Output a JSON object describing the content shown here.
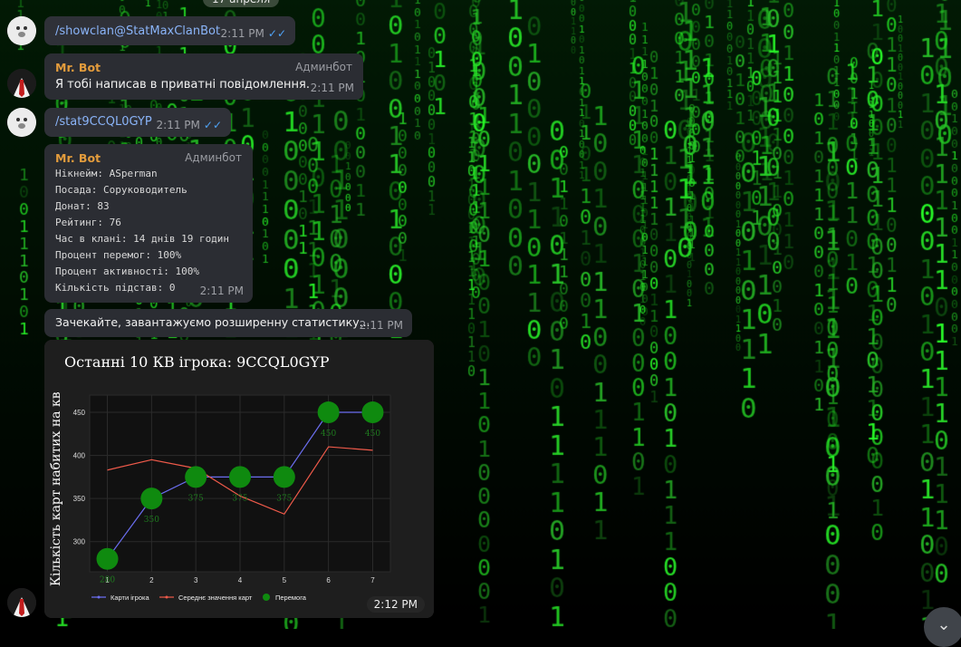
{
  "date_pill": "17 апреля",
  "messages": [
    {
      "type": "out",
      "text": "/showclan@StatMaxClanBot",
      "time": "2:11 PM"
    },
    {
      "type": "in",
      "sender": "Mr. Bot",
      "role": "Админбот",
      "text": "Я тобі написав в приватні повідомлення.",
      "time": "2:11 PM"
    },
    {
      "type": "out",
      "text": "/stat9CCQL0GYP",
      "time": "2:11 PM"
    },
    {
      "type": "in",
      "sender": "Mr. Bot",
      "role": "Админбот",
      "lines": [
        "Нікнейм: ASperman",
        "Посада: Соруководитель",
        "Донат: 83",
        "Рейтинг: 76",
        "Час в клані: 14 днів 19 годин",
        "Процент перемог: 100%",
        "Процент активності: 100%",
        "Кількість підстав: 0"
      ],
      "time": "2:11 PM"
    },
    {
      "type": "in",
      "text": "Зачекайте, завантажуємо розширенну статистику...",
      "time": "2:11 PM"
    }
  ],
  "chart_time": "2:12 PM",
  "chart_data": {
    "type": "line",
    "title": "Останні 10 КВ ігрока: 9CCQL0GYP",
    "ylabel": "Кількість карт набитих на кв",
    "xlabel": "",
    "x": [
      1,
      2,
      3,
      4,
      5,
      6,
      7
    ],
    "x_ticks": [
      "1",
      "2",
      "3",
      "4",
      "5",
      "6",
      "7"
    ],
    "y_ticks": [
      "300",
      "350",
      "400",
      "450"
    ],
    "ylim": [
      265,
      470
    ],
    "series": [
      {
        "name": "Карти ігрока",
        "color": "#6b6ef0",
        "values": [
          280,
          350,
          375,
          375,
          375,
          450,
          450
        ]
      },
      {
        "name": "Середнє значення карт",
        "color": "#ef5a4a",
        "values": [
          383,
          395,
          385,
          353,
          332,
          410,
          406
        ]
      }
    ],
    "markers": {
      "name": "Перемога",
      "color": "#0f8a0f",
      "x": [
        1,
        2,
        3,
        4,
        5,
        6,
        7
      ],
      "values": [
        280,
        350,
        375,
        375,
        375,
        450,
        450
      ],
      "labels": [
        "280",
        "350",
        "375",
        "375",
        "375",
        "450",
        "450"
      ]
    },
    "legend": "bottom",
    "grid": true
  }
}
